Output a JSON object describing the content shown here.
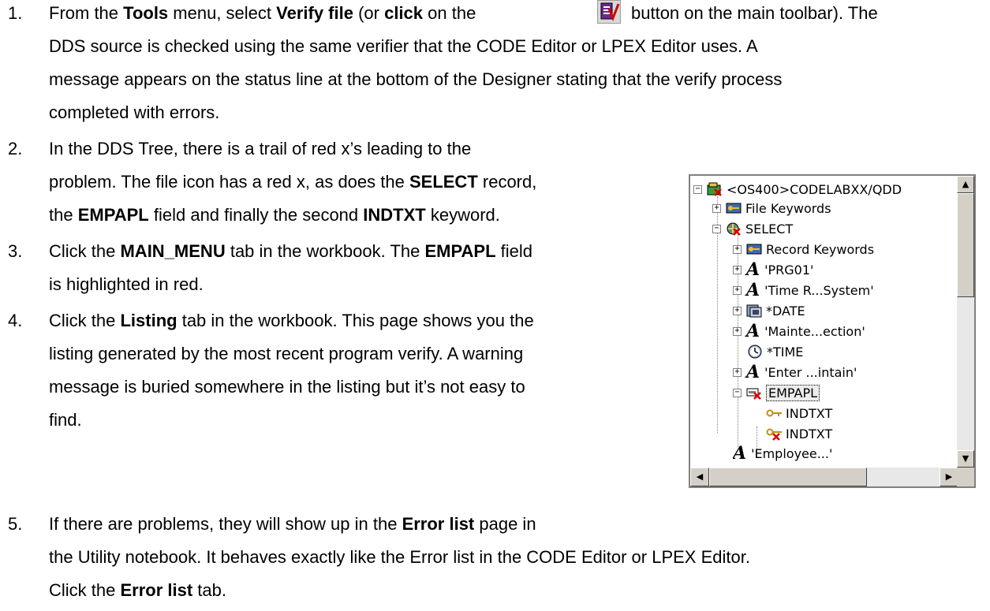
{
  "steps": [
    {
      "num": "1.",
      "l1a": "From the ",
      "l1b": "Tools",
      "l1c": " menu, select ",
      "l1d": "Verify file",
      "l1e": " (or ",
      "l1f": "click",
      "l1g": " on the",
      "l1h": "button on the main toolbar).  The",
      "l2": "DDS source is checked using the same verifier that the CODE Editor or LPEX Editor uses.  A",
      "l3": "message appears on the status line at the bottom of the Designer stating that the verify process",
      "l4": "completed with errors."
    },
    {
      "num": "2.",
      "l1": "In the DDS Tree, there is a trail of red x’s leading to the",
      "l2a": "problem.  The file icon has a red x, as does the ",
      "l2b": "SELECT",
      "l2c": " record,",
      "l3a": "the ",
      "l3b": "EMPAPL",
      "l3c": " field and finally the second ",
      "l3d": "INDTXT",
      "l3e": " keyword."
    },
    {
      "num": "3.",
      "l1a": "Click the ",
      "l1b": "MAIN_MENU",
      "l1c": " tab in the workbook.  The ",
      "l1d": "EMPAPL",
      "l1e": " field",
      "l2": "is highlighted in red."
    },
    {
      "num": "4.",
      "l1a": "Click the ",
      "l1b": "Listing",
      "l1c": " tab in the workbook.  This page shows you the",
      "l2": "listing generated by the most recent program verify.  A warning",
      "l3": "message is buried somewhere in the listing but it’s not easy to",
      "l4": "find."
    },
    {
      "num": "5.",
      "l1a": "If there are problems, they will show up in the ",
      "l1b": "Error list",
      "l1c": " page in",
      "l2": "the Utility notebook. It behaves exactly like the Error list in the CODE Editor or LPEX Editor.",
      "l3a": "Click the ",
      "l3b": "Error list",
      "l3c": " tab."
    }
  ],
  "tree": {
    "root": "<OS400>CODELABXX/QDD",
    "file_keywords": "File Keywords",
    "select": "SELECT",
    "record_keywords": "Record Keywords",
    "prg01": "'PRG01'",
    "time_system": "'Time R...System'",
    "date": "*DATE",
    "mainte": "'Mainte...ection'",
    "time": "*TIME",
    "enter": "'Enter ...intain'",
    "empapl": "EMPAPL",
    "indtxt1": "INDTXT",
    "indtxt2": "INDTXT",
    "cut_off": "'Employee...'"
  },
  "icons": [
    "verify-file-toolbar-icon",
    "expand-icon",
    "collapse-icon",
    "file-error-icon",
    "key-icon",
    "record-error-icon",
    "constant-A-icon",
    "date-icon",
    "clock-icon",
    "field-error-icon",
    "keyword-icon",
    "keyword-error-icon"
  ]
}
